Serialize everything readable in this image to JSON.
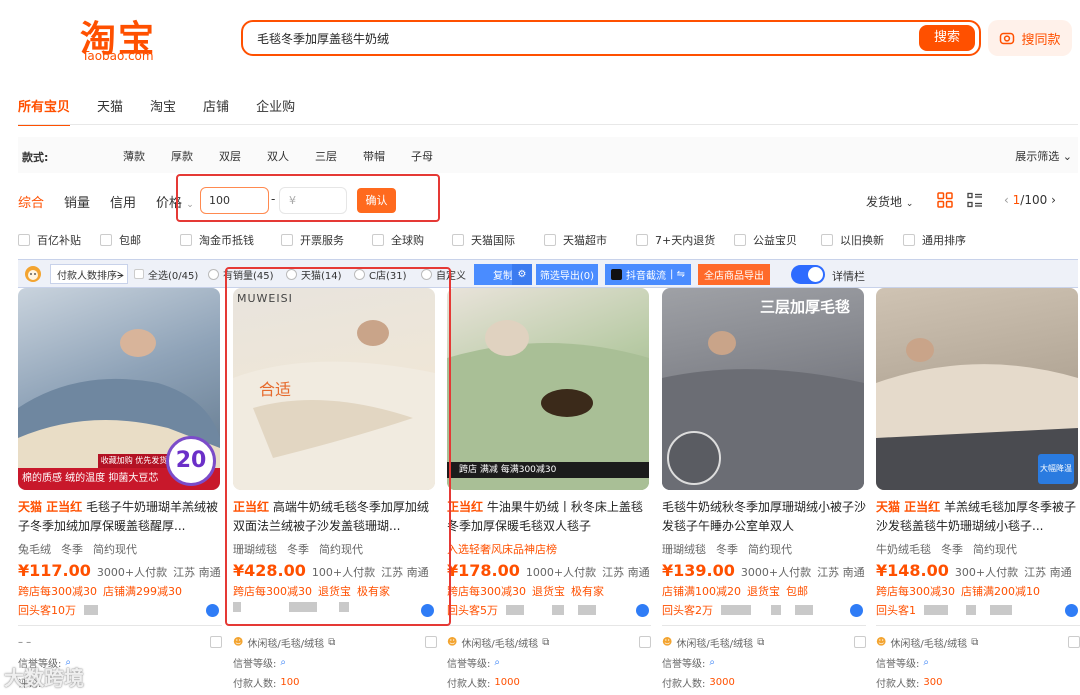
{
  "header": {
    "logo_cn": "淘宝",
    "logo_en": "Taobao.com",
    "search_value": "毛毯冬季加厚盖毯牛奶绒",
    "search_button": "搜索",
    "same_style_button": "搜同款"
  },
  "tabs": [
    "所有宝贝",
    "天猫",
    "淘宝",
    "店铺",
    "企业购"
  ],
  "style_filter": {
    "label": "款式:",
    "options": [
      "薄款",
      "厚款",
      "双层",
      "双人",
      "三层",
      "带帽",
      "子母"
    ],
    "expand": "展示筛选"
  },
  "sort": {
    "items": [
      "综合",
      "销量",
      "信用",
      "价格"
    ],
    "price_min": "100",
    "price_max_placeholder": "¥",
    "dash": "-",
    "confirm": "确认",
    "origin": "发货地",
    "page_current": "1",
    "page_total": "/100"
  },
  "services": [
    "百亿补贴",
    "包邮",
    "淘金币抵钱",
    "开票服务",
    "全球购",
    "天猫国际",
    "天猫超市",
    "7+天内退货",
    "公益宝贝",
    "以旧换新",
    "通用排序"
  ],
  "plugin": {
    "sort_select": "付款人数排序ᗒ",
    "select_all": "全选(0/45)",
    "has_sales": "有销量(45)",
    "tmall": "天猫(14)",
    "c_store": "C店(31)",
    "custom": "自定义",
    "copy": "复制",
    "filter_export": "筛选导出(0)",
    "douyin": "抖音截流",
    "all_export": "全店商品导出",
    "detail": "详情栏"
  },
  "products": [
    {
      "tag": "天猫 正当红",
      "title": "毛毯子牛奶珊瑚羊羔绒被子冬季加绒加厚保暖盖毯醒厚...",
      "attrs": [
        "兔毛绒",
        "冬季",
        "简约现代"
      ],
      "price": "¥117.00",
      "sold": "3000+人付款",
      "location": "江苏 南通",
      "promo1": "跨店每300减30",
      "promo2": "店铺满299减30",
      "last": "回头客10万",
      "img_caption": "棉的质感 绒的温度 抑菌大豆芯",
      "badge": "20",
      "badge_top": "收藏加购 优先发货",
      "colors": [
        "#8fa3b8",
        "#5d7388"
      ]
    },
    {
      "tag": "正当红",
      "title": "高端牛奶绒毛毯冬季加厚加绒双面法兰绒被子沙发盖毯珊瑚...",
      "attrs": [
        "珊瑚绒毯",
        "冬季",
        "简约现代"
      ],
      "price": "¥428.00",
      "sold": "100+人付款",
      "location": "江苏 南通",
      "promo1": "跨店每300减30",
      "promo2": "退货宝",
      "promo3": "极有家",
      "last": "",
      "img_caption": "MUWEISI",
      "note": "合适",
      "colors": [
        "#ece4d8",
        "#d8cbb6"
      ]
    },
    {
      "tag": "正当红",
      "title": "牛油果牛奶绒丨秋冬床上盖毯冬季加厚保暖毛毯双人毯子",
      "attrs": [
        "入选轻奢风床品神店榜"
      ],
      "price": "¥178.00",
      "sold": "1000+人付款",
      "location": "江苏 南通",
      "promo1": "跨店每300减30",
      "promo2": "退货宝",
      "promo3": "极有家",
      "last": "回头客5万",
      "img_caption": "跨店 满减 每满300减30",
      "colors": [
        "#b9cba6",
        "#8aa377"
      ]
    },
    {
      "tag": "",
      "title": "毛毯牛奶绒秋冬季加厚珊瑚绒小被子沙发毯子午睡办公室单双人",
      "attrs": [
        "珊瑚绒毯",
        "冬季",
        "简约现代"
      ],
      "price": "¥139.00",
      "sold": "3000+人付款",
      "location": "江苏 南通",
      "promo1": "店铺满100减20",
      "promo2": "退货宝",
      "promo3": "包邮",
      "last": "回头客2万",
      "img_caption": "三层加厚毛毯",
      "colors": [
        "#7d7f86",
        "#55575e"
      ]
    },
    {
      "tag": "天猫 正当红",
      "title": "羊羔绒毛毯加厚冬季被子沙发毯盖毯牛奶珊瑚绒小毯子...",
      "attrs": [
        "牛奶绒毛毯",
        "冬季",
        "简约现代"
      ],
      "price": "¥148.00",
      "sold": "300+人付款",
      "location": "江苏 南通",
      "promo1": "跨店每300减30",
      "promo2": "店铺满200减10",
      "last": "回头客1",
      "img_caption": "大幅降温",
      "colors": [
        "#d9cdbb",
        "#9b8f7e"
      ]
    }
  ],
  "store_info": {
    "category": "休闲毯/毛毯/绒毯",
    "credit_label": "信誉等级:",
    "paid_label": "付款人数:",
    "paid_counts": [
      "",
      "100",
      "1000",
      "3000",
      "300"
    ],
    "first_dash": "– –",
    "first_review": "评论:"
  },
  "watermark": "大数跨境",
  "colors": {
    "accent": "#ff5000",
    "annotation_red": "#e53935",
    "plugin_blue": "#4a8cff"
  }
}
